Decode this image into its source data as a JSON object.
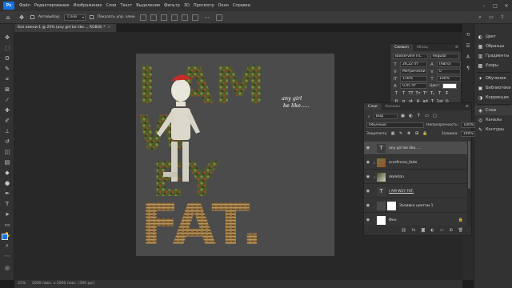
{
  "app": {
    "logo": "Ps"
  },
  "menu": [
    "Файл",
    "Редактирование",
    "Изображение",
    "Слои",
    "Текст",
    "Выделение",
    "Фильтр",
    "3D",
    "Просмотр",
    "Окно",
    "Справка"
  ],
  "window_controls": [
    "–",
    "□",
    "✕"
  ],
  "options_bar": {
    "auto_select_label": "Автовыбор:",
    "auto_select_value": "Слой",
    "show_controls_label": "Показать упр. элем."
  },
  "document_tab": {
    "title": "Без имени-1 @ 25% (any girl be like..., RGB/8) *",
    "close": "×"
  },
  "artwork": {
    "line1": "I AM",
    "line2": "W",
    "line3": "EY",
    "line4": "FAT.",
    "caption": "any girl\nbe like....."
  },
  "status_bar": {
    "zoom": "25%",
    "doc_info": "2000 пикс. x 2000 пикс. (300 ppi)"
  },
  "right_dock": {
    "items": [
      {
        "label": "Цвет",
        "icon": "color-icon"
      },
      {
        "label": "Образцы",
        "icon": "swatches-icon"
      },
      {
        "label": "Градиенты",
        "icon": "gradients-icon"
      },
      {
        "label": "Узоры",
        "icon": "patterns-icon"
      },
      {
        "label": "Обучение",
        "icon": "learn-icon"
      },
      {
        "label": "Библиотеки",
        "icon": "libraries-icon"
      },
      {
        "label": "Коррекция",
        "icon": "adjustments-icon"
      },
      {
        "label": "Слои",
        "icon": "layers-icon"
      },
      {
        "label": "Каналы",
        "icon": "channels-icon"
      },
      {
        "label": "Контуры",
        "icon": "paths-icon"
      }
    ]
  },
  "character_panel": {
    "tabs": [
      "Символ",
      "Абзац"
    ],
    "font_family": "Baskerville ITC",
    "font_style": "Regular",
    "font_size": "26,22 пт",
    "leading": "(Авто)",
    "kerning": "Метрически",
    "tracking": "0",
    "vertical_scale": "110%",
    "horizontal_scale": "100%",
    "baseline_shift": "0,45 пт",
    "color_label": "Цвет:",
    "color_value": "#ffffff",
    "formatting": [
      "T",
      "T",
      "TT",
      "Tт",
      "T¹",
      "T₁",
      "T",
      "T̶"
    ],
    "opentype": [
      "fi",
      "σ",
      "st",
      "A",
      "ad",
      "T",
      "1st",
      "½"
    ],
    "language": "Английский: США",
    "antialias": "Резкое"
  },
  "layers_panel": {
    "tabs": [
      "Слои",
      "Каналы"
    ],
    "filter_label": "Вид",
    "blend_mode": "Обычные",
    "opacity_label": "Непрозрачность:",
    "opacity_value": "100%",
    "lock_label": "Закрепить:",
    "fill_label": "Заливка:",
    "fill_value": "100%",
    "layers": [
      {
        "name": "any girl be like.....",
        "kind": "text",
        "selected": true
      },
      {
        "name": "scarfinnes_fade",
        "kind": "image",
        "selected": false
      },
      {
        "name": "skeleton",
        "kind": "image",
        "selected": false
      },
      {
        "name": "I AM WEY FAT.",
        "kind": "text",
        "selected": false
      },
      {
        "name": "Заливка цветом 1",
        "kind": "fill",
        "selected": false
      },
      {
        "name": "Фон",
        "kind": "background",
        "selected": false
      }
    ],
    "footer_icons": [
      "link-icon",
      "fx-icon",
      "mask-icon",
      "adjustment-icon",
      "group-icon",
      "new-layer-icon",
      "trash-icon"
    ]
  }
}
